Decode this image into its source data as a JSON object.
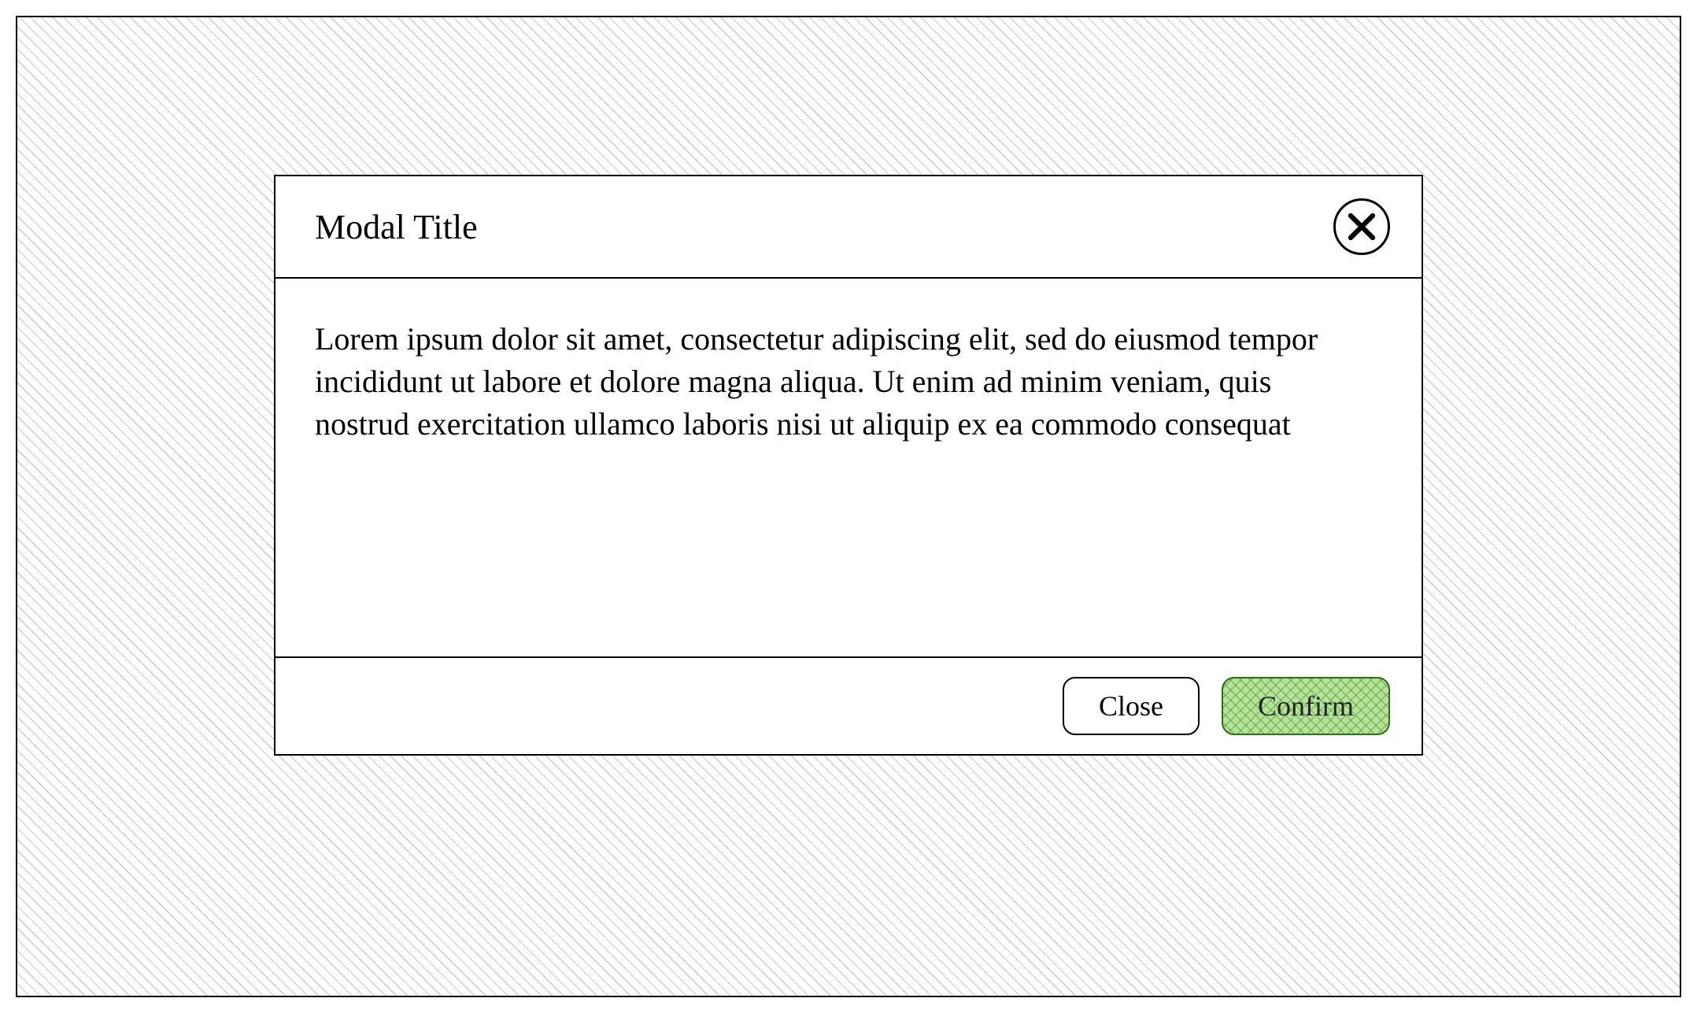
{
  "modal": {
    "title": "Modal Title",
    "body_text": "Lorem ipsum dolor sit amet, consectetur adipiscing elit, sed do eiusmod tempor incididunt ut labore et dolore magna aliqua. Ut enim ad minim veniam, quis nostrud exercitation ullamco laboris nisi ut aliquip ex ea commodo consequat",
    "close_icon": "close-icon",
    "footer": {
      "close_label": "Close",
      "confirm_label": "Confirm"
    }
  },
  "colors": {
    "confirm_bg": "#b6e39a",
    "confirm_border": "#2e6b1f",
    "hatch": "#c9c9c9"
  }
}
